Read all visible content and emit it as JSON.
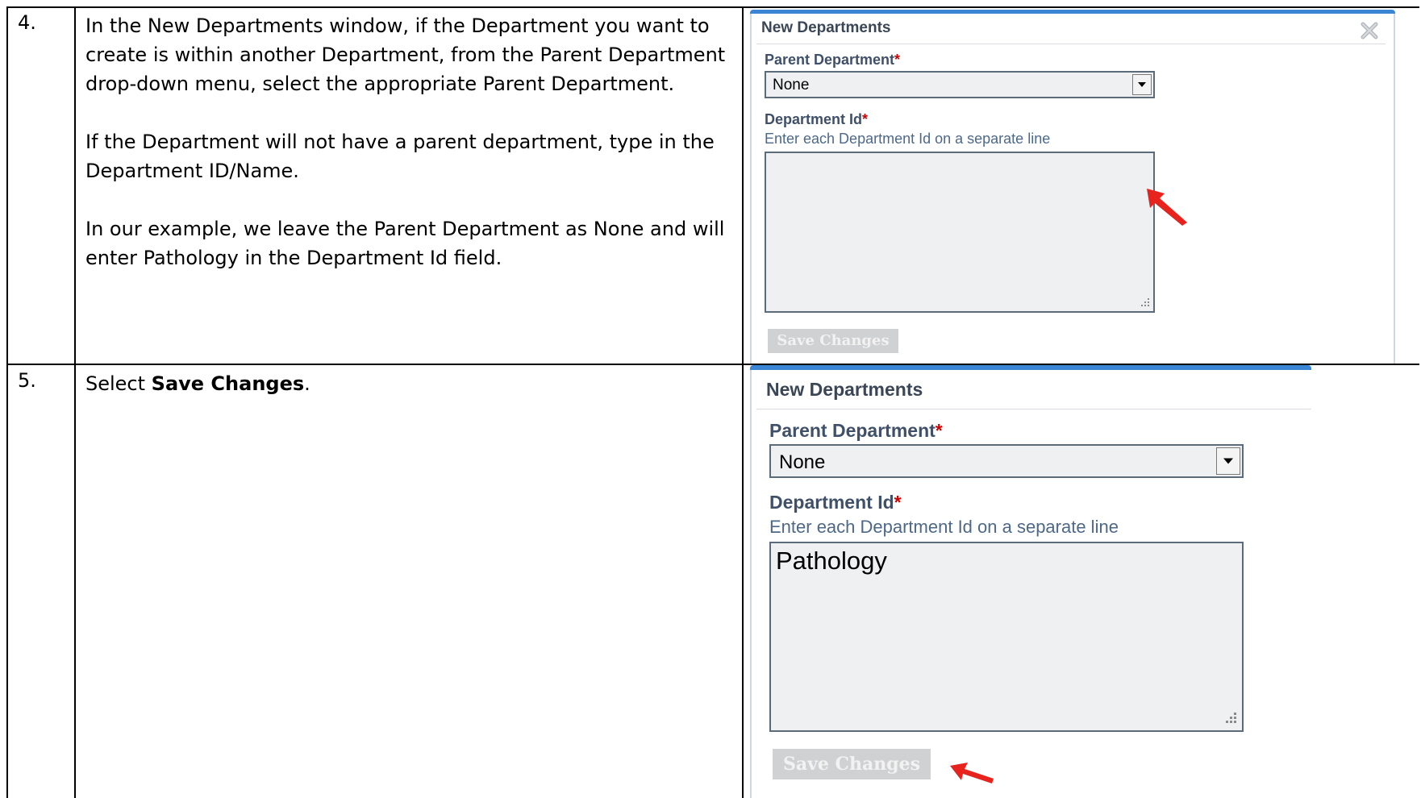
{
  "steps": [
    {
      "number": "4.",
      "paragraphs": [
        "In the New Departments window, if the Department you want to create is within another Department, from the Parent Department drop-down menu, select the appropriate Parent Department.",
        "If the Department will not have a parent department, type in the Department ID/Name.",
        "In our example, we leave the Parent Department as None and will enter Pathology in the Department Id field."
      ],
      "dialog": {
        "title": "New Departments",
        "parent_label": "Parent Department",
        "required_mark": "*",
        "parent_value": "None",
        "id_label": "Department Id",
        "id_hint": "Enter each Department Id on a separate line",
        "id_value": "",
        "save_label": "Save Changes"
      }
    },
    {
      "number": "5.",
      "text_prefix": "Select ",
      "text_bold": "Save Changes",
      "text_suffix": ".",
      "dialog": {
        "title": "New Departments",
        "parent_label": "Parent Department",
        "required_mark": "*",
        "parent_value": "None",
        "id_label": "Department Id",
        "id_hint": "Enter each Department Id on a separate line",
        "id_value": "Pathology",
        "save_label": "Save Changes"
      }
    }
  ],
  "colors": {
    "accent_bar": "#3b86d4",
    "arrow": "#e8231e",
    "required": "#cc0000"
  },
  "icons": [
    "close-icon",
    "chevron-down-icon",
    "resize-grip-icon",
    "arrow-pointer-icon"
  ]
}
